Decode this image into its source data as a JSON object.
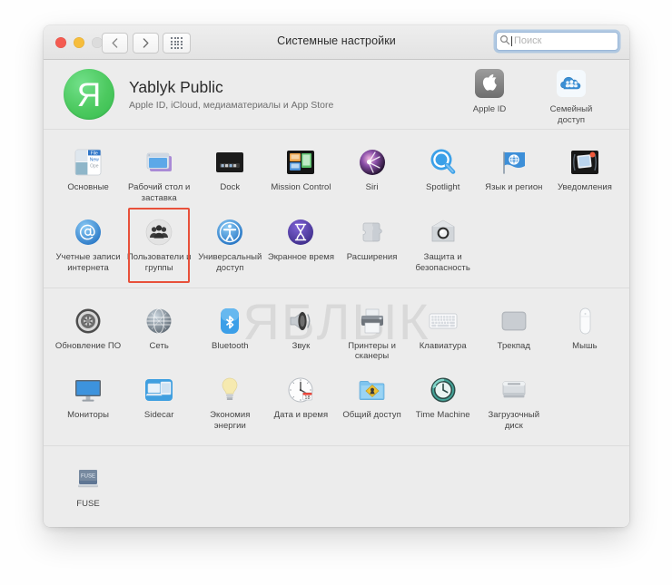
{
  "window": {
    "title": "Системные настройки",
    "traffic_lights": [
      "close",
      "minimize",
      "zoom"
    ],
    "nav": {
      "back": "back-chevron",
      "forward": "forward-chevron",
      "grid": "show-all-grid"
    }
  },
  "search": {
    "placeholder": "Поиск",
    "value": ""
  },
  "account": {
    "avatar_letter": "Я",
    "name": "Yablyk Public",
    "subtitle": "Apple ID, iCloud, медиаматериалы и App Store",
    "shortcuts": [
      {
        "label": "Apple ID",
        "icon": "apple-id-icon"
      },
      {
        "label": "Семейный доступ",
        "icon": "family-sharing-icon"
      }
    ]
  },
  "sections": [
    {
      "name": "personal",
      "items": [
        {
          "label": "Основные",
          "icon": "general-icon",
          "highlighted": false
        },
        {
          "label": "Рабочий стол и заставка",
          "icon": "desktop-screensaver-icon",
          "highlighted": false
        },
        {
          "label": "Dock",
          "icon": "dock-icon",
          "highlighted": false
        },
        {
          "label": "Mission Control",
          "icon": "mission-control-icon",
          "highlighted": false
        },
        {
          "label": "Siri",
          "icon": "siri-icon",
          "highlighted": false
        },
        {
          "label": "Spotlight",
          "icon": "spotlight-icon",
          "highlighted": false
        },
        {
          "label": "Язык и регион",
          "icon": "language-region-icon",
          "highlighted": false
        },
        {
          "label": "Уведомления",
          "icon": "notifications-icon",
          "highlighted": false
        },
        {
          "label": "Учетные записи интернета",
          "icon": "internet-accounts-icon",
          "highlighted": false
        },
        {
          "label": "Пользователи и группы",
          "icon": "users-groups-icon",
          "highlighted": true
        },
        {
          "label": "Универсальный доступ",
          "icon": "accessibility-icon",
          "highlighted": false
        },
        {
          "label": "Экранное время",
          "icon": "screen-time-icon",
          "highlighted": false
        },
        {
          "label": "Расширения",
          "icon": "extensions-icon",
          "highlighted": false
        },
        {
          "label": "Защита и безопасность",
          "icon": "security-privacy-icon",
          "highlighted": false
        }
      ]
    },
    {
      "name": "hardware",
      "items": [
        {
          "label": "Обновление ПО",
          "icon": "software-update-icon",
          "highlighted": false
        },
        {
          "label": "Сеть",
          "icon": "network-icon",
          "highlighted": false
        },
        {
          "label": "Bluetooth",
          "icon": "bluetooth-icon",
          "highlighted": false
        },
        {
          "label": "Звук",
          "icon": "sound-icon",
          "highlighted": false
        },
        {
          "label": "Принтеры и сканеры",
          "icon": "printers-scanners-icon",
          "highlighted": false
        },
        {
          "label": "Клавиатура",
          "icon": "keyboard-icon",
          "highlighted": false
        },
        {
          "label": "Трекпад",
          "icon": "trackpad-icon",
          "highlighted": false
        },
        {
          "label": "Мышь",
          "icon": "mouse-icon",
          "highlighted": false
        },
        {
          "label": "Мониторы",
          "icon": "displays-icon",
          "highlighted": false
        },
        {
          "label": "Sidecar",
          "icon": "sidecar-icon",
          "highlighted": false
        },
        {
          "label": "Экономия энергии",
          "icon": "energy-saver-icon",
          "highlighted": false
        },
        {
          "label": "Дата и время",
          "icon": "date-time-icon",
          "highlighted": false
        },
        {
          "label": "Общий доступ",
          "icon": "sharing-icon",
          "highlighted": false
        },
        {
          "label": "Time Machine",
          "icon": "time-machine-icon",
          "highlighted": false
        },
        {
          "label": "Загрузочный диск",
          "icon": "startup-disk-icon",
          "highlighted": false
        }
      ]
    },
    {
      "name": "third-party",
      "items": [
        {
          "label": "FUSE",
          "icon": "fuse-icon",
          "highlighted": false
        }
      ]
    }
  ],
  "watermark": {
    "text": "ЯБЛЫК",
    "apple_glyph": ""
  },
  "date_badge": "18",
  "colors": {
    "highlight": "#e8503a",
    "accent_blue": "#2f8fe0",
    "avatar_green": "#4cc95f",
    "window_bg": "#ececec"
  }
}
